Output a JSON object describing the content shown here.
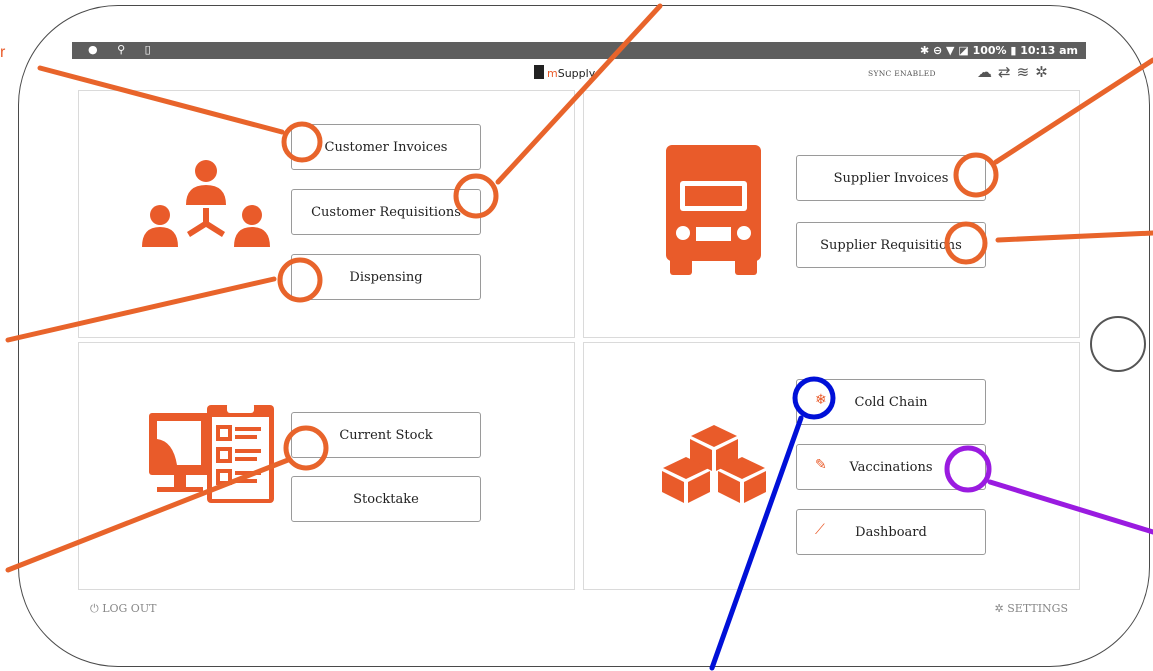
{
  "hint_text": "r",
  "status": {
    "right": "✱ ⊖ ▼ ◪ 100% ▮ 10:13 am"
  },
  "app": {
    "brand_m": "m",
    "brand_rest": "Supply",
    "sync_label": "SYNC ENABLED"
  },
  "buttons": {
    "customer_invoices": "Customer Invoices",
    "customer_requisitions": "Customer Requisitions",
    "dispensing": "Dispensing",
    "supplier_invoices": "Supplier Invoices",
    "supplier_requisitions": "Supplier Requisitions",
    "current_stock": "Current Stock",
    "stocktake": "Stocktake",
    "cold_chain": "Cold Chain",
    "vaccinations": "Vaccinations",
    "dashboard": "Dashboard"
  },
  "footer": {
    "logout": "LOG OUT",
    "settings": "SETTINGS"
  },
  "colors": {
    "accent": "#e95b2a",
    "annotation_orange": "#e8642b",
    "annotation_blue": "#0010d8",
    "annotation_purple": "#9a1be0"
  }
}
